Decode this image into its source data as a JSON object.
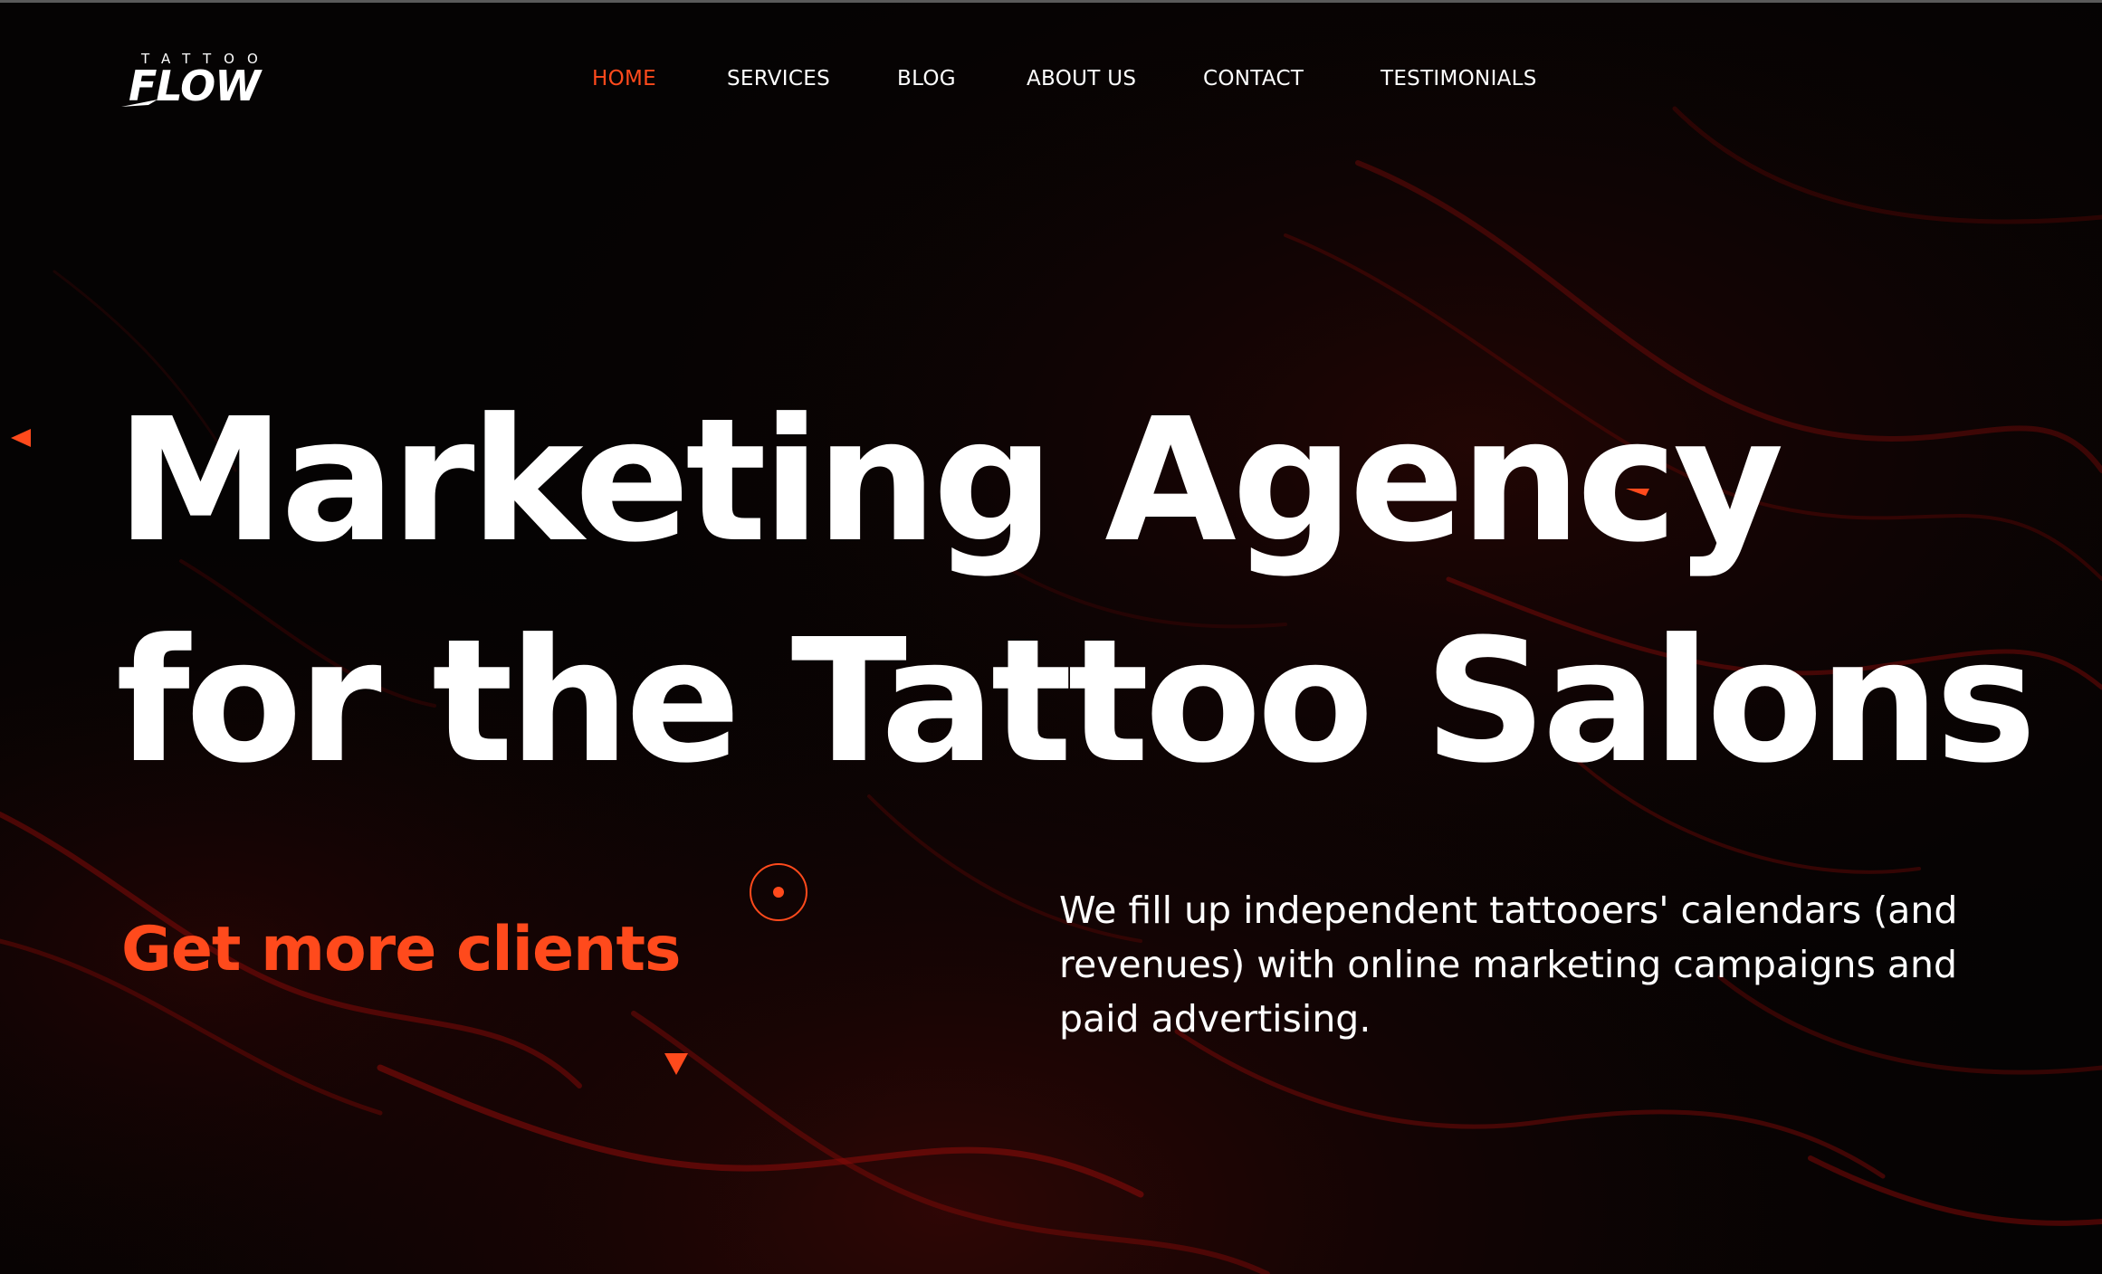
{
  "brand": {
    "logo_small": "TATTOO",
    "logo_big": "FLOW"
  },
  "nav": {
    "items": [
      {
        "label": "HOME",
        "active": true
      },
      {
        "label": "SERVICES",
        "active": false
      },
      {
        "label": "BLOG",
        "active": false
      },
      {
        "label": "ABOUT US",
        "active": false
      },
      {
        "label": "CONTACT",
        "active": false
      },
      {
        "label": "TESTIMONIALS",
        "active": false
      }
    ]
  },
  "hero": {
    "headline_line1": "Marketing Agency",
    "headline_line2": "for the Tattoo Salons",
    "cta": "Get more clients",
    "description": "We fill up independent tattooers' calendars (and revenues) with online marketing campaigns and paid advertising."
  },
  "colors": {
    "accent": "#ff4a1c",
    "background": "#050303",
    "text": "#ffffff",
    "texture": "#8a0a08"
  },
  "icons": {
    "left_arrow": "triangle-left-icon",
    "down_arrow": "triangle-down-icon",
    "circle_target": "circle-dot-icon"
  }
}
